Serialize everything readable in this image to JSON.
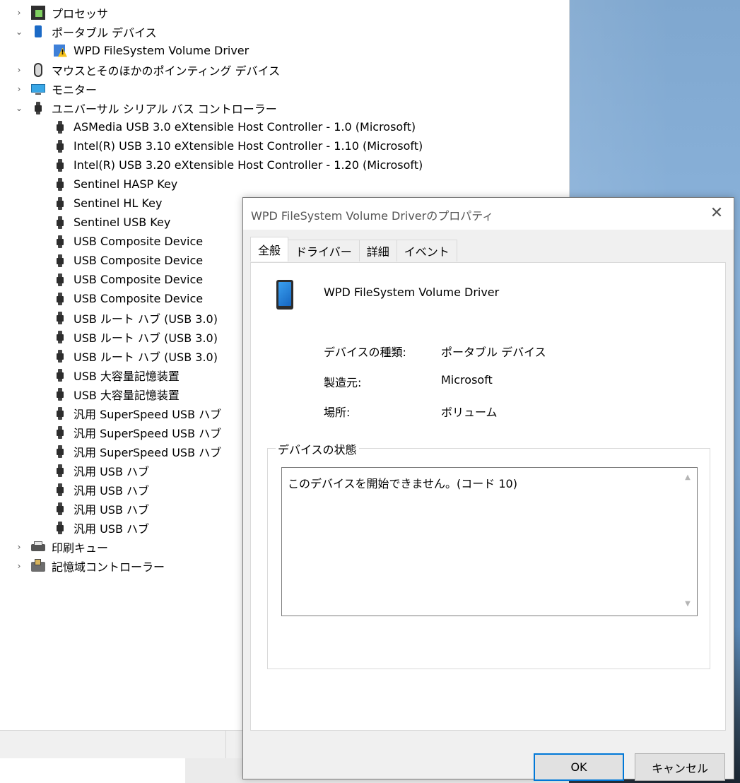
{
  "device_manager": {
    "tree": [
      {
        "label": "プロセッサ",
        "icon": "cpu-icon",
        "expand": "›"
      },
      {
        "label": "ポータブル デバイス",
        "icon": "portable-device-icon",
        "expand": "⌄"
      },
      {
        "label": "WPD FileSystem Volume Driver",
        "icon": "warning-device-icon",
        "expand": ""
      },
      {
        "label": "マウスとそのほかのポインティング デバイス",
        "icon": "mouse-icon",
        "expand": "›"
      },
      {
        "label": "モニター",
        "icon": "monitor-icon",
        "expand": "›"
      },
      {
        "label": "ユニバーサル シリアル バス コントローラー",
        "icon": "usb-icon",
        "expand": "⌄"
      },
      {
        "label": "ASMedia USB 3.0 eXtensible Host Controller - 1.0 (Microsoft)",
        "icon": "usb-icon",
        "expand": ""
      },
      {
        "label": "Intel(R) USB 3.10 eXtensible Host Controller - 1.10 (Microsoft)",
        "icon": "usb-icon",
        "expand": ""
      },
      {
        "label": "Intel(R) USB 3.20 eXtensible Host Controller - 1.20 (Microsoft)",
        "icon": "usb-icon",
        "expand": ""
      },
      {
        "label": "Sentinel HASP Key",
        "icon": "usb-icon",
        "expand": ""
      },
      {
        "label": "Sentinel HL Key",
        "icon": "usb-icon",
        "expand": ""
      },
      {
        "label": "Sentinel USB Key",
        "icon": "usb-icon",
        "expand": ""
      },
      {
        "label": "USB Composite Device",
        "icon": "usb-icon",
        "expand": ""
      },
      {
        "label": "USB Composite Device",
        "icon": "usb-icon",
        "expand": ""
      },
      {
        "label": "USB Composite Device",
        "icon": "usb-icon",
        "expand": ""
      },
      {
        "label": "USB Composite Device",
        "icon": "usb-icon",
        "expand": ""
      },
      {
        "label": "USB ルート ハブ (USB 3.0)",
        "icon": "usb-icon",
        "expand": ""
      },
      {
        "label": "USB ルート ハブ (USB 3.0)",
        "icon": "usb-icon",
        "expand": ""
      },
      {
        "label": "USB ルート ハブ (USB 3.0)",
        "icon": "usb-icon",
        "expand": ""
      },
      {
        "label": "USB 大容量記憶装置",
        "icon": "usb-icon",
        "expand": ""
      },
      {
        "label": "USB 大容量記憶装置",
        "icon": "usb-icon",
        "expand": ""
      },
      {
        "label": "汎用 SuperSpeed USB ハブ",
        "icon": "usb-icon",
        "expand": ""
      },
      {
        "label": "汎用 SuperSpeed USB ハブ",
        "icon": "usb-icon",
        "expand": ""
      },
      {
        "label": "汎用 SuperSpeed USB ハブ",
        "icon": "usb-icon",
        "expand": ""
      },
      {
        "label": "汎用 USB ハブ",
        "icon": "usb-icon",
        "expand": ""
      },
      {
        "label": "汎用 USB ハブ",
        "icon": "usb-icon",
        "expand": ""
      },
      {
        "label": "汎用 USB ハブ",
        "icon": "usb-icon",
        "expand": ""
      },
      {
        "label": "汎用 USB ハブ",
        "icon": "usb-icon",
        "expand": ""
      },
      {
        "label": "印刷キュー",
        "icon": "printer-icon",
        "expand": "›"
      },
      {
        "label": "記憶域コントローラー",
        "icon": "storage-controller-icon",
        "expand": "›"
      }
    ]
  },
  "dialog": {
    "title": "WPD FileSystem Volume Driverのプロパティ",
    "close_glyph": "✕",
    "tabs": [
      {
        "label": "全般",
        "active": true
      },
      {
        "label": "ドライバー",
        "active": false
      },
      {
        "label": "詳細",
        "active": false
      },
      {
        "label": "イベント",
        "active": false
      }
    ],
    "device_name": "WPD FileSystem Volume Driver",
    "properties": [
      {
        "label": "デバイスの種類:",
        "value": "ポータブル デバイス"
      },
      {
        "label": "製造元:",
        "value": "Microsoft"
      },
      {
        "label": "場所:",
        "value": "ボリューム"
      }
    ],
    "status_group_label": "デバイスの状態",
    "status_text": "このデバイスを開始できません。(コード 10)",
    "scroll_up_glyph": "▲",
    "scroll_down_glyph": "▼",
    "ok_label": "OK",
    "cancel_label": "キャンセル"
  },
  "colors": {
    "accent": "#0078d7",
    "warning": "#f6c21c"
  }
}
